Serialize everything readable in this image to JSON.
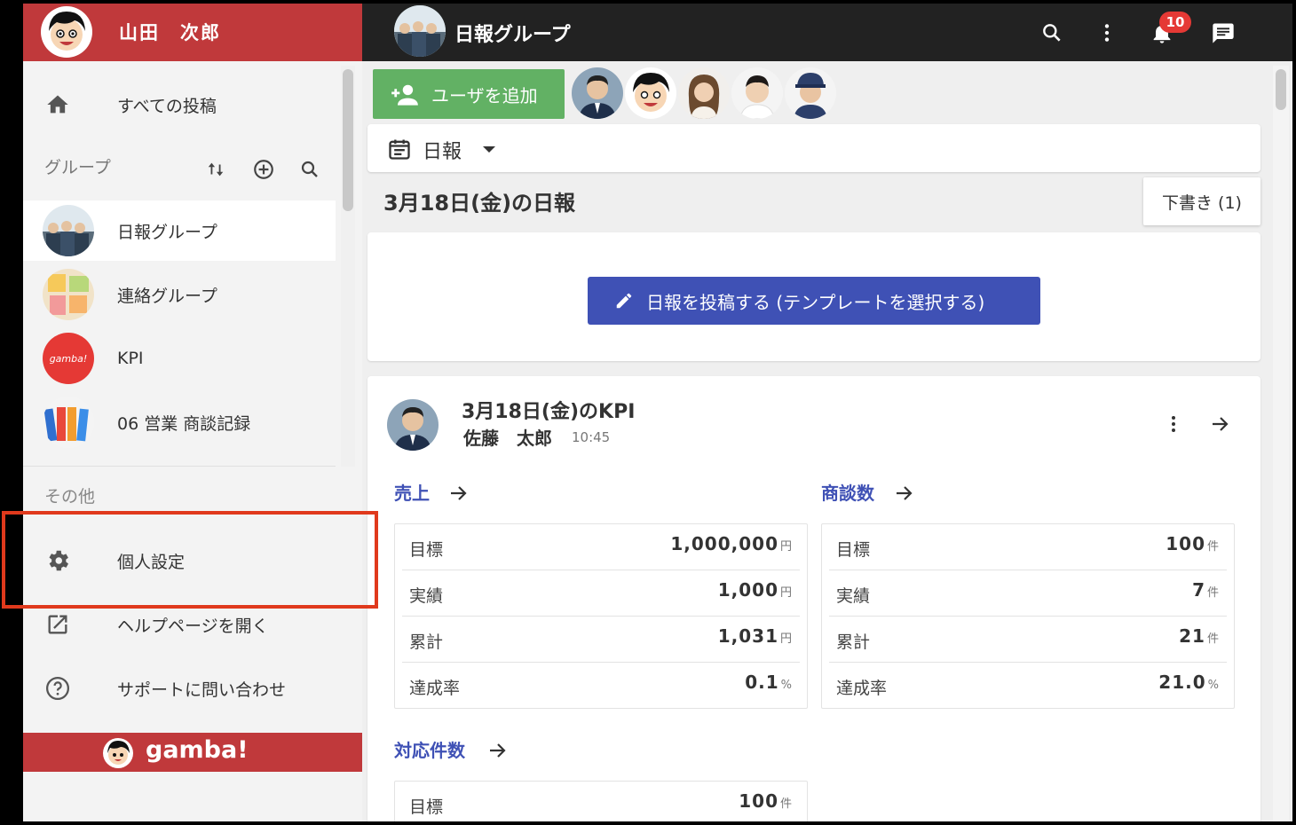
{
  "user": {
    "name": "山田　次郎"
  },
  "sidebar": {
    "all_posts": "すべての投稿",
    "groups_header": "グループ",
    "groups": [
      {
        "label": "日報グループ"
      },
      {
        "label": "連絡グループ"
      },
      {
        "label": "KPI",
        "logo_text": "gamba!"
      },
      {
        "label": "06 営業 商談記録"
      }
    ],
    "other_header": "その他",
    "other_items": [
      {
        "label": "個人設定"
      },
      {
        "label": "ヘルプページを開く"
      },
      {
        "label": "サポートに問い合わせ"
      }
    ],
    "brand": "gamba!"
  },
  "topbar": {
    "title": "日報グループ",
    "notification_count": "10"
  },
  "toolbar": {
    "add_user_label": "ユーザを追加",
    "report_type": "日報",
    "date_title": "3月18日(金)の日報",
    "draft_label": "下書き (1)",
    "post_button_label": "日報を投稿する (テンプレートを選択する)"
  },
  "kpi": {
    "title": "3月18日(金)のKPI",
    "author": "佐藤　太郎",
    "time": "10:45",
    "sections": [
      {
        "title": "売上",
        "rows": [
          {
            "key": "目標",
            "value": "1,000,000",
            "unit": "円"
          },
          {
            "key": "実績",
            "value": "1,000",
            "unit": "円"
          },
          {
            "key": "累計",
            "value": "1,031",
            "unit": "円"
          },
          {
            "key": "達成率",
            "value": "0.1",
            "unit": "%"
          }
        ]
      },
      {
        "title": "商談数",
        "rows": [
          {
            "key": "目標",
            "value": "100",
            "unit": "件"
          },
          {
            "key": "実績",
            "value": "7",
            "unit": "件"
          },
          {
            "key": "累計",
            "value": "21",
            "unit": "件"
          },
          {
            "key": "達成率",
            "value": "21.0",
            "unit": "%"
          }
        ]
      },
      {
        "title": "対応件数",
        "rows": [
          {
            "key": "目標",
            "value": "100",
            "unit": "件"
          }
        ]
      }
    ]
  },
  "colors": {
    "brand_red": "#c0393b",
    "topbar": "#222222",
    "add_user_green": "#62b164",
    "primary_indigo": "#3f51b5",
    "highlight": "#e0391c"
  }
}
